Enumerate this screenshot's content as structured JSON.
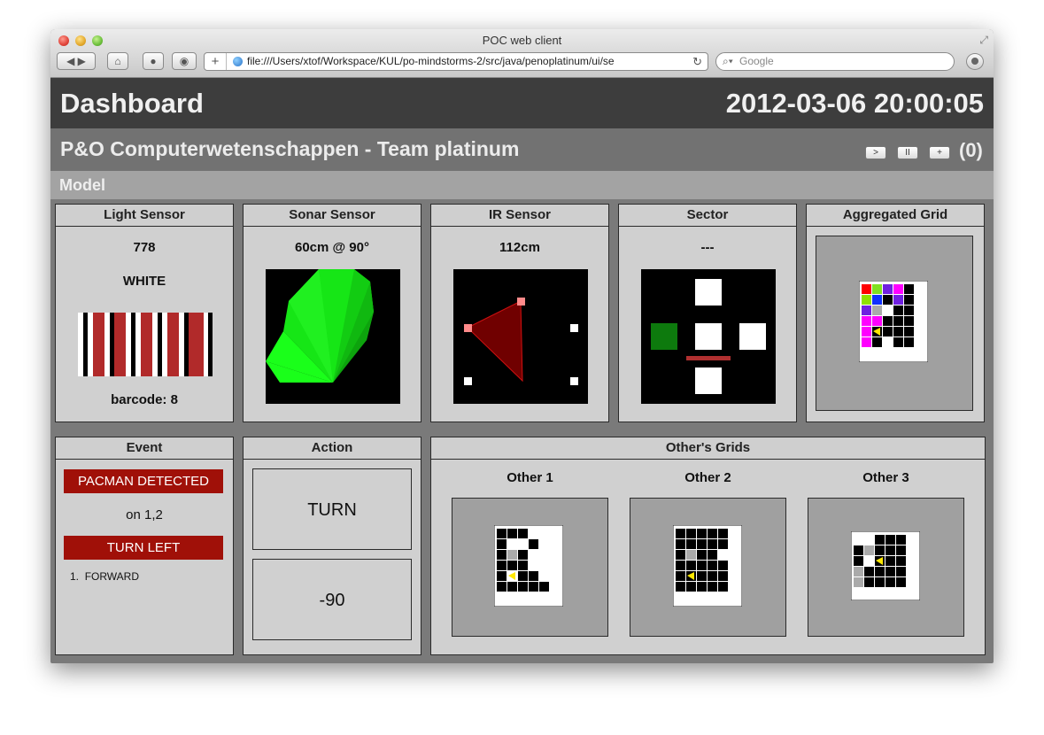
{
  "browser": {
    "window_title": "POC web client",
    "url": "file:///Users/xtof/Workspace/KUL/po-mindstorms-2/src/java/penoplatinum/ui/se",
    "search_placeholder": "Google"
  },
  "dashboard": {
    "title": "Dashboard",
    "datetime": "2012-03-06 20:00:05",
    "team": "P&O Computerwetenschappen - Team platinum",
    "controls": {
      "play": ">",
      "pause": "II",
      "add": "+",
      "count": "(0)"
    },
    "section": "Model"
  },
  "panels": {
    "light": {
      "title": "Light Sensor",
      "value": "778",
      "color": "WHITE",
      "barcode_label": "barcode: 8"
    },
    "sonar": {
      "title": "Sonar Sensor",
      "value": "60cm @ 90°"
    },
    "ir": {
      "title": "IR Sensor",
      "value": "112cm"
    },
    "sector": {
      "title": "Sector",
      "value": "---"
    },
    "aggregated": {
      "title": "Aggregated Grid"
    },
    "event": {
      "title": "Event",
      "badge": "PACMAN DETECTED",
      "location": "on 1,2",
      "next": "TURN LEFT",
      "queue": [
        "FORWARD"
      ]
    },
    "action": {
      "title": "Action",
      "name": "TURN",
      "value": "-90"
    },
    "others": {
      "title": "Other's Grids",
      "items": [
        "Other 1",
        "Other 2",
        "Other 3"
      ]
    }
  },
  "colors": {
    "header_dark": "#3d3d3d",
    "header_mid": "#727272",
    "header_light": "#a3a3a3",
    "panel_bg": "#d0d0d0",
    "event_red": "#a01008",
    "sonar_green": "#22dd22",
    "ir_red": "#7a0000"
  }
}
